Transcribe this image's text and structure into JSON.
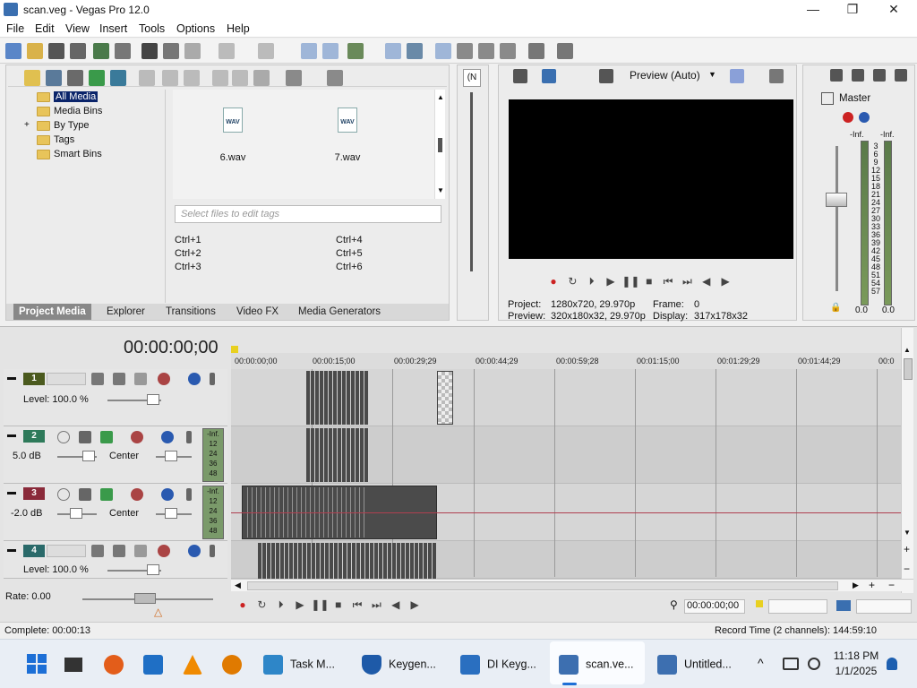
{
  "window": {
    "title": "scan.veg - Vegas Pro 12.0",
    "min": "—",
    "max": "❐",
    "close": "✕"
  },
  "menu": [
    "File",
    "Edit",
    "View",
    "Insert",
    "Tools",
    "Options",
    "Help"
  ],
  "tree": {
    "items": [
      "All Media",
      "Media Bins",
      "By Type",
      "Tags",
      "Smart Bins"
    ],
    "expander": "+"
  },
  "files": [
    {
      "label": "6.wav",
      "badge": "WAV"
    },
    {
      "label": "7.wav",
      "badge": "WAV"
    }
  ],
  "tags": {
    "placeholder": "Select files to edit tags",
    "shortcuts": [
      "Ctrl+1",
      "Ctrl+2",
      "Ctrl+3",
      "Ctrl+4",
      "Ctrl+5",
      "Ctrl+6"
    ]
  },
  "tabs": [
    "Project Media",
    "Explorer",
    "Transitions",
    "Video FX",
    "Media Generators"
  ],
  "preview": {
    "mode": "Preview (Auto)",
    "trimmer_label": "(N",
    "project_label": "Project:",
    "project": "1280x720, 29.970p",
    "frame_label": "Frame:",
    "frame": "0",
    "preview_label": "Preview:",
    "preview": "320x180x32, 29.970p",
    "display_label": "Display:",
    "display": "317x178x32"
  },
  "master": {
    "label": "Master",
    "left_peak": "-Inf.",
    "right_peak": "-Inf.",
    "scale": [
      "3",
      "6",
      "9",
      "12",
      "15",
      "18",
      "21",
      "24",
      "27",
      "30",
      "33",
      "36",
      "39",
      "42",
      "45",
      "48",
      "51",
      "54",
      "57"
    ],
    "left_value": "0.0",
    "right_value": "0.0"
  },
  "timecode": "00:00:00;00",
  "ruler": [
    "00:00:00;00",
    "00:00:15;00",
    "00:00:29;29",
    "00:00:44;29",
    "00:00:59;28",
    "00:01:15;00",
    "00:01:29;29",
    "00:01:44;29",
    "00:0"
  ],
  "tracks": [
    {
      "num": "1",
      "type": "video",
      "level": "Level: 100.0 %",
      "color": "#4b5a1e"
    },
    {
      "num": "2",
      "type": "audio",
      "vol": "5.0 dB",
      "pan": "Center",
      "color": "#2e7a5a",
      "meter": [
        "-Inf.",
        "12",
        "24",
        "36",
        "48"
      ]
    },
    {
      "num": "3",
      "type": "audio",
      "vol": "-2.0 dB",
      "pan": "Center",
      "color": "#8a2a3a",
      "meter": [
        "-Inf.",
        "12",
        "24",
        "36",
        "48"
      ]
    },
    {
      "num": "4",
      "type": "video",
      "level": "Level: 100.0 %",
      "color": "#2a6a6a"
    }
  ],
  "rate": "Rate: 0.00",
  "transport_time": "00:00:00;00",
  "status": {
    "left": "Complete: 00:00:13",
    "right": "Record Time (2 channels): 144:59:10"
  },
  "taskbar": {
    "apps": [
      {
        "label": "",
        "color": "#e35d1a"
      },
      {
        "label": "",
        "color": "#1f6fc5"
      },
      {
        "label": "",
        "color": "#f08a00"
      },
      {
        "label": "",
        "color": "#e07a00"
      },
      {
        "label": "Task M...",
        "color": "#2e86c8"
      },
      {
        "label": "Keygen...",
        "color": "#1e5aa8"
      },
      {
        "label": "DI Keyg...",
        "color": "#2a6fc0"
      },
      {
        "label": "scan.ve...",
        "color": "#3d6fb0"
      },
      {
        "label": "Untitled...",
        "color": "#3d6fb0"
      }
    ],
    "time": "11:18 PM",
    "date": "1/1/2025",
    "tray_chevron": "^"
  }
}
